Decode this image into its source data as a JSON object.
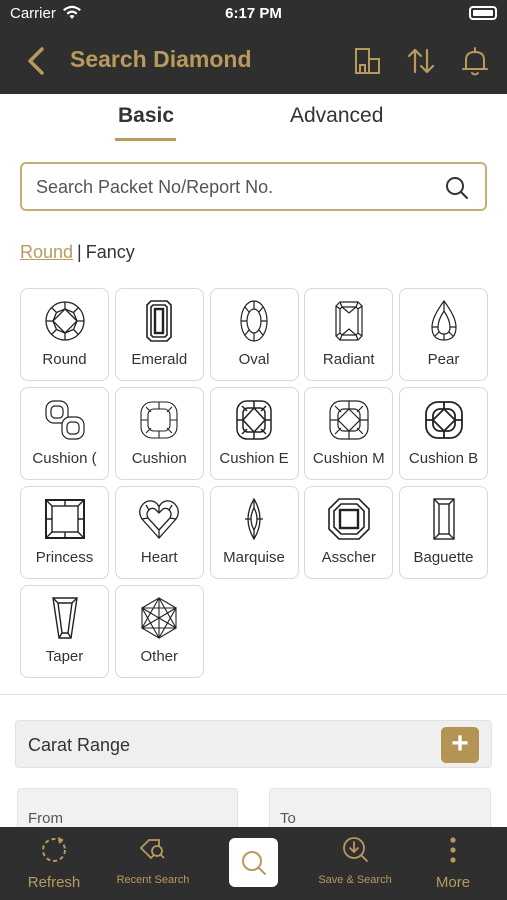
{
  "status": {
    "carrier": "Carrier",
    "time": "6:17 PM"
  },
  "nav": {
    "title": "Search Diamond"
  },
  "tabs": {
    "basic": "Basic",
    "advanced": "Advanced"
  },
  "search": {
    "placeholder": "Search Packet No/Report No."
  },
  "shape_toggle": {
    "round": "Round",
    "separator": "|",
    "fancy": "Fancy"
  },
  "shapes": [
    {
      "label": "Round",
      "icon": "round-diamond-icon"
    },
    {
      "label": "Emerald",
      "icon": "emerald-diamond-icon"
    },
    {
      "label": "Oval",
      "icon": "oval-diamond-icon"
    },
    {
      "label": "Radiant",
      "icon": "radiant-diamond-icon"
    },
    {
      "label": "Pear",
      "icon": "pear-diamond-icon"
    },
    {
      "label": "Cushion (",
      "icon": "cushion-pair-diamond-icon"
    },
    {
      "label": "Cushion",
      "icon": "cushion-diamond-icon"
    },
    {
      "label": "Cushion E",
      "icon": "cushion-e-diamond-icon"
    },
    {
      "label": "Cushion M",
      "icon": "cushion-m-diamond-icon"
    },
    {
      "label": "Cushion B",
      "icon": "cushion-b-diamond-icon"
    },
    {
      "label": "Princess",
      "icon": "princess-diamond-icon"
    },
    {
      "label": "Heart",
      "icon": "heart-diamond-icon"
    },
    {
      "label": "Marquise",
      "icon": "marquise-diamond-icon"
    },
    {
      "label": "Asscher",
      "icon": "asscher-diamond-icon"
    },
    {
      "label": "Baguette",
      "icon": "baguette-diamond-icon"
    },
    {
      "label": "Taper",
      "icon": "taper-diamond-icon"
    },
    {
      "label": "Other",
      "icon": "other-diamond-icon"
    }
  ],
  "carat": {
    "title": "Carat Range",
    "plus": "+",
    "from_placeholder": "From",
    "to_placeholder": "To"
  },
  "bottom_bar": {
    "refresh": "Refresh",
    "recent_search": "Recent Search",
    "save_search": "Save & Search",
    "more": "More"
  },
  "colors": {
    "accent": "#b89a5d",
    "bar": "#2f2f2f",
    "border": "#d8d8d8"
  }
}
